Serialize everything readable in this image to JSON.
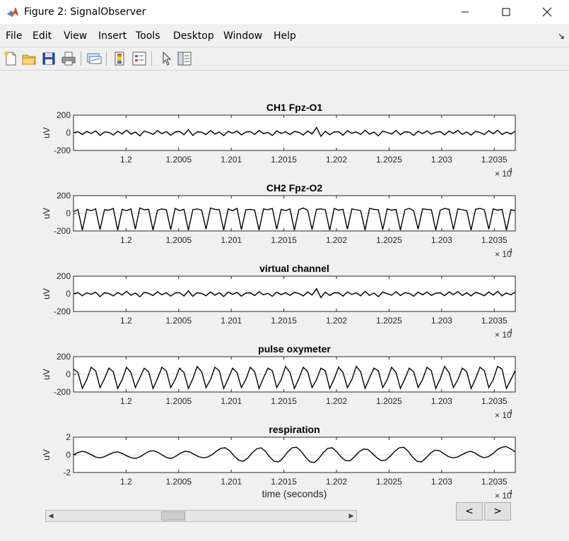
{
  "window": {
    "title": "Figure 2: SignalObserver",
    "controls": [
      "minimize",
      "maximize",
      "close"
    ]
  },
  "menu": {
    "items": [
      "File",
      "Edit",
      "View",
      "Insert",
      "Tools",
      "Desktop",
      "Window",
      "Help"
    ]
  },
  "toolbar": {
    "buttons": [
      "new-figure-icon",
      "open-file-icon",
      "save-icon",
      "print-icon",
      "link-plot-icon",
      "insert-colorbar-icon",
      "insert-legend-icon",
      "edit-plot-arrow-icon",
      "property-inspector-icon"
    ]
  },
  "nav": {
    "prev_label": "<",
    "next_label": ">"
  },
  "chart_data": [
    {
      "type": "line",
      "title": "CH1 Fpz-O1",
      "ylabel": "uV",
      "xlabel": "",
      "xlim": [
        11995,
        12037
      ],
      "ylim": [
        -200,
        200
      ],
      "yticks": [
        "200",
        "0",
        "-200"
      ],
      "xticks": [
        12000,
        12005,
        12010,
        12015,
        12020,
        12025,
        12030,
        12035
      ],
      "xtick_labels": [
        "1.2",
        "1.2005",
        "1.201",
        "1.2015",
        "1.202",
        "1.2025",
        "1.203",
        "1.2035"
      ],
      "exponent": "10",
      "exponent_power": "4",
      "series": [
        {
          "values": [
            0,
            12,
            -20,
            15,
            -8,
            22,
            -30,
            10,
            5,
            -25,
            18,
            -12,
            30,
            -15,
            8,
            -35,
            20,
            3,
            -18,
            25,
            -10,
            14,
            -28,
            9,
            16,
            -22,
            35,
            -30,
            12,
            6,
            -20,
            24,
            -14,
            10,
            -32,
            18,
            -5,
            20,
            -24,
            8,
            14,
            -18,
            26,
            -10,
            4,
            -30,
            22,
            -8,
            12,
            -20,
            16,
            6,
            -26,
            20,
            -12,
            60,
            -40,
            18,
            -22,
            10,
            14,
            -28,
            24,
            -6,
            10,
            -20,
            30,
            -16,
            8,
            -34,
            20,
            4,
            -14,
            26,
            -22,
            12,
            8,
            -30,
            18,
            -10,
            22,
            -16,
            6,
            14,
            -24,
            20,
            -8,
            28,
            -18,
            10,
            -26,
            16,
            4,
            -20,
            24,
            -12,
            30,
            -20,
            8,
            -14,
            18
          ]
        }
      ]
    },
    {
      "type": "line",
      "title": "CH2 Fpz-O2",
      "ylabel": "uV",
      "xlabel": "",
      "xlim": [
        11995,
        12037
      ],
      "ylim": [
        -200,
        200
      ],
      "yticks": [
        "200",
        "0",
        "-200"
      ],
      "xticks": [
        12000,
        12005,
        12010,
        12015,
        12020,
        12025,
        12030,
        12035
      ],
      "xtick_labels": [
        "1.2",
        "1.2005",
        "1.201",
        "1.2015",
        "1.202",
        "1.2025",
        "1.203",
        "1.2035"
      ],
      "exponent": "10",
      "exponent_power": "4",
      "series": [
        {
          "values": [
            20,
            40,
            -190,
            45,
            30,
            50,
            -185,
            40,
            35,
            55,
            -190,
            45,
            30,
            50,
            -180,
            60,
            40,
            45,
            -190,
            35,
            50,
            40,
            -185,
            55,
            30,
            45,
            -190,
            40,
            50,
            35,
            -180,
            60,
            45,
            40,
            -190,
            50,
            30,
            55,
            -185,
            40,
            45,
            35,
            -190,
            50,
            40,
            55,
            -180,
            45,
            30,
            50,
            -190,
            40,
            60,
            35,
            -185,
            45,
            50,
            40,
            -190,
            55,
            35,
            45,
            -180,
            50,
            40,
            30,
            -190,
            55,
            45,
            40,
            -185,
            50,
            35,
            45,
            -190,
            40,
            55,
            30,
            -180,
            50,
            45,
            40,
            -190,
            35,
            55,
            45,
            -185,
            50,
            40,
            30,
            -190,
            45,
            55,
            40,
            -180,
            50,
            35,
            45,
            -190,
            40,
            30
          ]
        }
      ]
    },
    {
      "type": "line",
      "title": "virtual channel",
      "ylabel": "uV",
      "xlabel": "",
      "xlim": [
        11995,
        12037
      ],
      "ylim": [
        -200,
        200
      ],
      "yticks": [
        "200",
        "0",
        "-200"
      ],
      "xticks": [
        12000,
        12005,
        12010,
        12015,
        12020,
        12025,
        12030,
        12035
      ],
      "xtick_labels": [
        "1.2",
        "1.2005",
        "1.201",
        "1.2015",
        "1.202",
        "1.2025",
        "1.203",
        "1.2035"
      ],
      "exponent": "10",
      "exponent_power": "4",
      "series": [
        {
          "values": [
            0,
            14,
            -22,
            12,
            -6,
            20,
            -32,
            12,
            4,
            -24,
            16,
            -14,
            28,
            -16,
            10,
            -34,
            18,
            5,
            -20,
            24,
            -12,
            12,
            -26,
            10,
            14,
            -24,
            33,
            -28,
            14,
            4,
            -22,
            22,
            -16,
            12,
            -30,
            20,
            -6,
            18,
            -26,
            10,
            12,
            -20,
            24,
            -12,
            6,
            -28,
            20,
            -10,
            14,
            -18,
            18,
            4,
            -24,
            22,
            -14,
            58,
            -42,
            20,
            -20,
            12,
            12,
            -26,
            22,
            -8,
            12,
            -22,
            28,
            -18,
            10,
            -32,
            22,
            2,
            -16,
            24,
            -20,
            14,
            6,
            -28,
            20,
            -12,
            20,
            -18,
            8,
            12,
            -22,
            22,
            -10,
            26,
            -20,
            12,
            -24,
            18,
            2,
            -22,
            22,
            -14,
            28,
            -22,
            10,
            -12,
            20
          ]
        }
      ]
    },
    {
      "type": "line",
      "title": "pulse oxymeter",
      "ylabel": "uV",
      "xlabel": "",
      "xlim": [
        11995,
        12037
      ],
      "ylim": [
        -200,
        200
      ],
      "yticks": [
        "200",
        "0",
        "-200"
      ],
      "xticks": [
        12000,
        12005,
        12010,
        12015,
        12020,
        12025,
        12030,
        12035
      ],
      "xtick_labels": [
        "1.2",
        "1.2005",
        "1.201",
        "1.2015",
        "1.202",
        "1.2025",
        "1.203",
        "1.2035"
      ],
      "exponent": "10",
      "exponent_power": "4",
      "series": [
        {
          "values": [
            60,
            20,
            -160,
            -60,
            80,
            40,
            -150,
            -50,
            70,
            30,
            -160,
            -60,
            80,
            20,
            -150,
            -40,
            70,
            30,
            -160,
            -50,
            80,
            40,
            -150,
            -60,
            70,
            20,
            -160,
            -50,
            90,
            30,
            -150,
            -60,
            80,
            40,
            -160,
            -50,
            70,
            20,
            -150,
            -60,
            80,
            30,
            -160,
            -40,
            70,
            40,
            -150,
            -60,
            90,
            20,
            -160,
            -50,
            80,
            30,
            -150,
            -60,
            70,
            40,
            -160,
            -50,
            80,
            20,
            -150,
            -60,
            90,
            30,
            -160,
            -40,
            70,
            40,
            -150,
            -60,
            80,
            20,
            -160,
            -50,
            70,
            30,
            -150,
            -60,
            80,
            40,
            -160,
            -50,
            90,
            20,
            -150,
            -60,
            70,
            30,
            -160,
            -50,
            80,
            40,
            -150,
            -60,
            90,
            60,
            -160,
            -60,
            40
          ]
        }
      ]
    },
    {
      "type": "line",
      "title": "respiration",
      "ylabel": "uV",
      "xlabel": "time (seconds)",
      "xlim": [
        11995,
        12037
      ],
      "ylim": [
        -3,
        3
      ],
      "yticks": [
        "2",
        "0",
        "-2"
      ],
      "xticks": [
        12000,
        12005,
        12010,
        12015,
        12020,
        12025,
        12030,
        12035
      ],
      "xtick_labels": [
        "1.2",
        "1.2005",
        "1.201",
        "1.2015",
        "1.202",
        "1.2025",
        "1.203",
        "1.2035"
      ],
      "exponent": "10",
      "exponent_power": "4",
      "series": [
        {
          "values": [
            0,
            0.4,
            0.6,
            0.4,
            0,
            -0.4,
            -0.5,
            -0.3,
            0.1,
            0.4,
            0.5,
            0.2,
            -0.2,
            -0.5,
            -0.6,
            -0.3,
            0.2,
            0.6,
            0.7,
            0.4,
            -0.1,
            -0.5,
            -0.6,
            -0.2,
            0.3,
            0.6,
            0.5,
            0.1,
            -0.3,
            -0.5,
            -0.4,
            0,
            0.6,
            1.1,
            1.2,
            0.7,
            -0.2,
            -0.9,
            -1.1,
            -0.6,
            0.3,
            1.0,
            1.2,
            0.6,
            -0.4,
            -1.1,
            -1.2,
            -0.5,
            0.5,
            1.2,
            1.3,
            0.6,
            -0.4,
            -1.2,
            -1.3,
            -0.6,
            0.4,
            1.1,
            1.2,
            0.5,
            -0.4,
            -1.0,
            -1.0,
            -0.3,
            0.5,
            1.0,
            0.9,
            0.2,
            -0.5,
            -1.0,
            -0.9,
            -0.2,
            0.6,
            1.2,
            1.3,
            0.6,
            -0.4,
            -1.1,
            -1.2,
            -0.5,
            0.3,
            0.8,
            0.7,
            0.2,
            -0.3,
            -0.5,
            -0.4,
            0,
            0.4,
            0.6,
            0.3,
            -0.2,
            -0.5,
            -0.3,
            0.2,
            0.9,
            1.3,
            1.4,
            1.0,
            0.5
          ]
        }
      ]
    }
  ]
}
